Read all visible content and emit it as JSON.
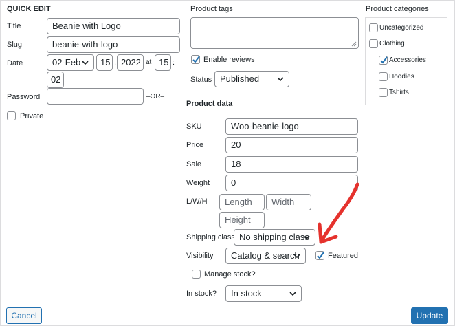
{
  "quick_edit": {
    "heading": "QUICK EDIT",
    "title_label": "Title",
    "title_value": "Beanie with Logo",
    "slug_label": "Slug",
    "slug_value": "beanie-with-logo",
    "date_label": "Date",
    "date_month": "02-Feb",
    "date_day": "15",
    "date_comma": ",",
    "date_year": "2022",
    "date_at": "at",
    "date_hour": "15",
    "date_colon": ":",
    "date_minute": "02",
    "password_label": "Password",
    "password_or": "–OR–",
    "private_label": "Private"
  },
  "tags": {
    "label": "Product tags",
    "enable_reviews_label": "Enable reviews",
    "enable_reviews_checked": true,
    "status_label": "Status",
    "status_value": "Published"
  },
  "categories": {
    "label": "Product categories",
    "items": [
      {
        "label": "Uncategorized",
        "checked": false
      },
      {
        "label": "Clothing",
        "checked": false
      },
      {
        "label": "Accessories",
        "checked": true
      },
      {
        "label": "Hoodies",
        "checked": false
      },
      {
        "label": "Tshirts",
        "checked": false
      }
    ]
  },
  "product_data": {
    "heading": "Product data",
    "sku_label": "SKU",
    "sku_value": "Woo-beanie-logo",
    "price_label": "Price",
    "price_value": "20",
    "sale_label": "Sale",
    "sale_value": "18",
    "weight_label": "Weight",
    "weight_value": "0",
    "lwh_label": "L/W/H",
    "length_placeholder": "Length",
    "width_placeholder": "Width",
    "height_placeholder": "Height",
    "shipping_label": "Shipping class",
    "shipping_value": "No shipping class",
    "visibility_label": "Visibility",
    "visibility_value": "Catalog & search",
    "featured_label": "Featured",
    "featured_checked": true,
    "manage_stock_label": "Manage stock?",
    "in_stock_label": "In stock?",
    "in_stock_value": "In stock"
  },
  "buttons": {
    "cancel": "Cancel",
    "update": "Update"
  },
  "colors": {
    "accent": "#2271b1",
    "annotation_arrow": "#e5322d"
  }
}
